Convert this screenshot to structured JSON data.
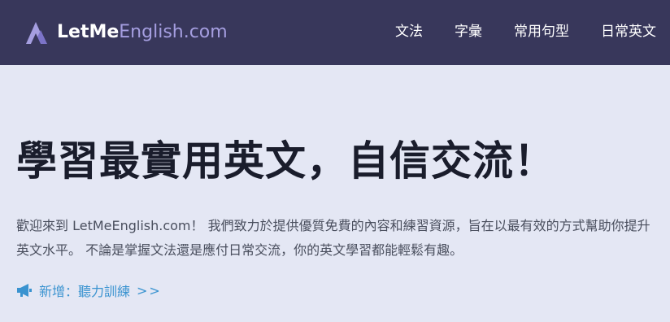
{
  "header": {
    "logo": {
      "icon": "logo-triangle-icon",
      "text_primary": "LetMe",
      "text_secondary": "English.com",
      "colors": {
        "primary": "#ffffff",
        "secondary": "#a59ee0",
        "mark": "#a59ee0"
      }
    },
    "nav": [
      {
        "label": "文法"
      },
      {
        "label": "字彙"
      },
      {
        "label": "常用句型"
      },
      {
        "label": "日常英文"
      }
    ],
    "background": "#38375b"
  },
  "hero": {
    "title": "學習最實用英文，自信交流！",
    "intro": "歡迎來到 LetMeEnglish.com！ 我們致力於提供優質免費的內容和練習資源，旨在以最有效的方式幫助你提升英文水平。 不論是掌握文法還是應付日常交流，你的英文學習都能輕鬆有趣。",
    "announcement": {
      "icon": "megaphone-icon",
      "label": "新增：聽力訓練",
      "arrows": ">>",
      "color": "#3a93d0"
    }
  },
  "page": {
    "background": "#e4e7f4"
  }
}
